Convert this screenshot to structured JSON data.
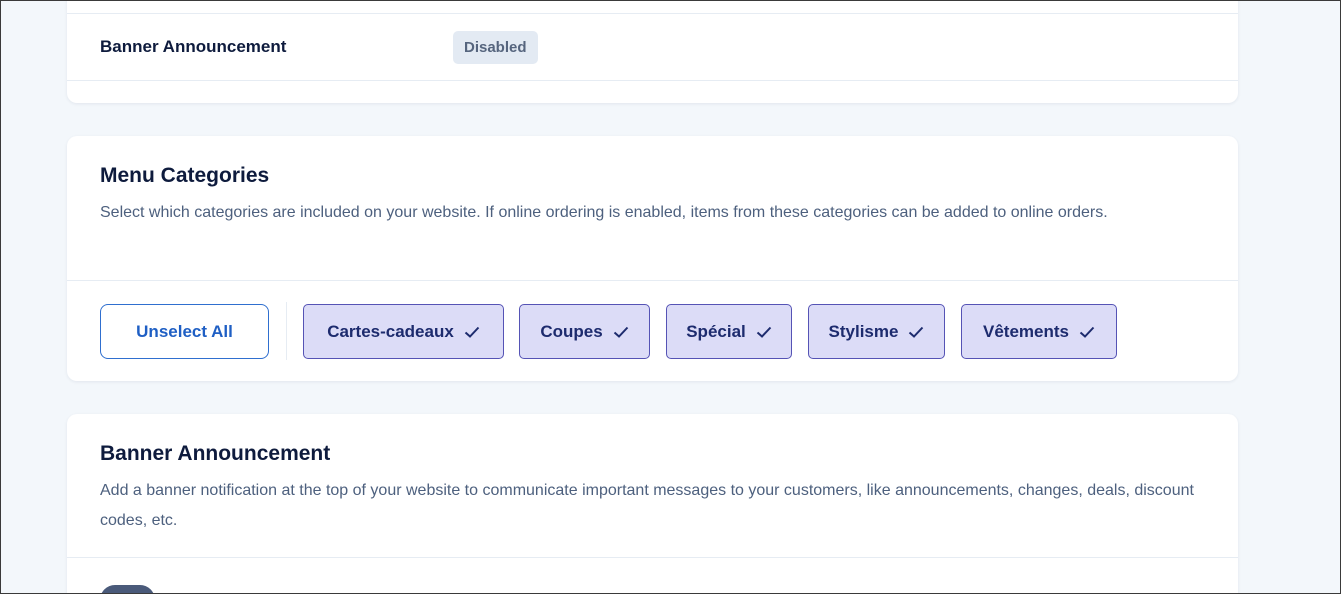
{
  "status_card": {
    "row_label": "Banner Announcement",
    "status_badge": "Disabled"
  },
  "menu_categories": {
    "title": "Menu Categories",
    "description": "Select which categories are included on your website. If online ordering is enabled, items from these categories can be added to online orders.",
    "unselect_all_label": "Unselect All",
    "chips": [
      {
        "label": "Cartes-cadeaux",
        "selected": true
      },
      {
        "label": "Coupes",
        "selected": true
      },
      {
        "label": "Spécial",
        "selected": true
      },
      {
        "label": "Stylisme",
        "selected": true
      },
      {
        "label": "Vêtements",
        "selected": true
      }
    ],
    "chip_icon": "check-icon"
  },
  "banner_announcement": {
    "title": "Banner Announcement",
    "description": "Add a banner notification at the top of your website to communicate important messages to your customers, like announcements, changes, deals, discount codes, etc.",
    "toggle_icon": "toggle-switch"
  },
  "colors": {
    "page_background": "#f3f7fb",
    "card_background": "#ffffff",
    "heading_text": "#0e1b3d",
    "body_text": "#4d607e",
    "primary_outline": "#2f6fcf",
    "chip_background": "#dcdcf7",
    "chip_border": "#5553b5",
    "badge_background": "#e3eaf3"
  }
}
